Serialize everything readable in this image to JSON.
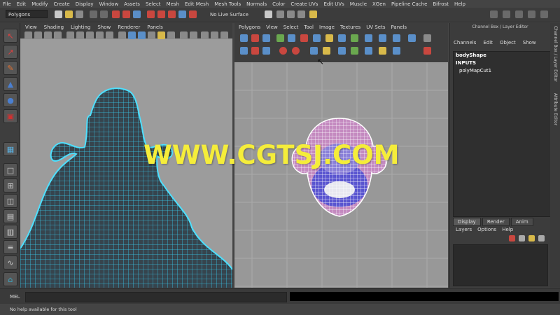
{
  "menubar": {
    "items": [
      "File",
      "Edit",
      "Modify",
      "Create",
      "Display",
      "Window",
      "Assets",
      "Select",
      "Mesh",
      "Edit Mesh",
      "Mesh Tools",
      "Normals",
      "Color",
      "Create UVs",
      "Edit UVs",
      "Muscle",
      "XGen",
      "Pipeline Cache",
      "Bifrost",
      "Help"
    ]
  },
  "shelf": {
    "mode": "Polygons",
    "live_surface": "No Live Surface"
  },
  "viewport": {
    "menus": [
      "View",
      "Shading",
      "Lighting",
      "Show",
      "Renderer",
      "Panels"
    ]
  },
  "uv_editor": {
    "menus": [
      "Polygons",
      "View",
      "Select",
      "Tool",
      "Image",
      "Textures",
      "UV Sets",
      "Panels"
    ]
  },
  "channel_box": {
    "title": "Channel Box / Layer Editor",
    "menus": [
      "Channels",
      "Edit",
      "Object",
      "Show"
    ],
    "shape": "bodyShape",
    "inputs_label": "INPUTS",
    "input_node": "polyMapCut1"
  },
  "layer_editor": {
    "tabs": [
      "Display",
      "Render",
      "Anim"
    ],
    "menus": [
      "Layers",
      "Options",
      "Help"
    ]
  },
  "side_tabs": [
    "Channel Box / Layer Editor",
    "Attribute Editor"
  ],
  "command_line": {
    "label": "MEL"
  },
  "help_line": "No help available for this tool",
  "watermark": "WWW.CGTSJ.COM",
  "colors": {
    "wire_viewport": "#38c8ec",
    "uv_pink": "#b066a8",
    "uv_blue": "#4846c8",
    "watermark": "#f5ed3a"
  }
}
